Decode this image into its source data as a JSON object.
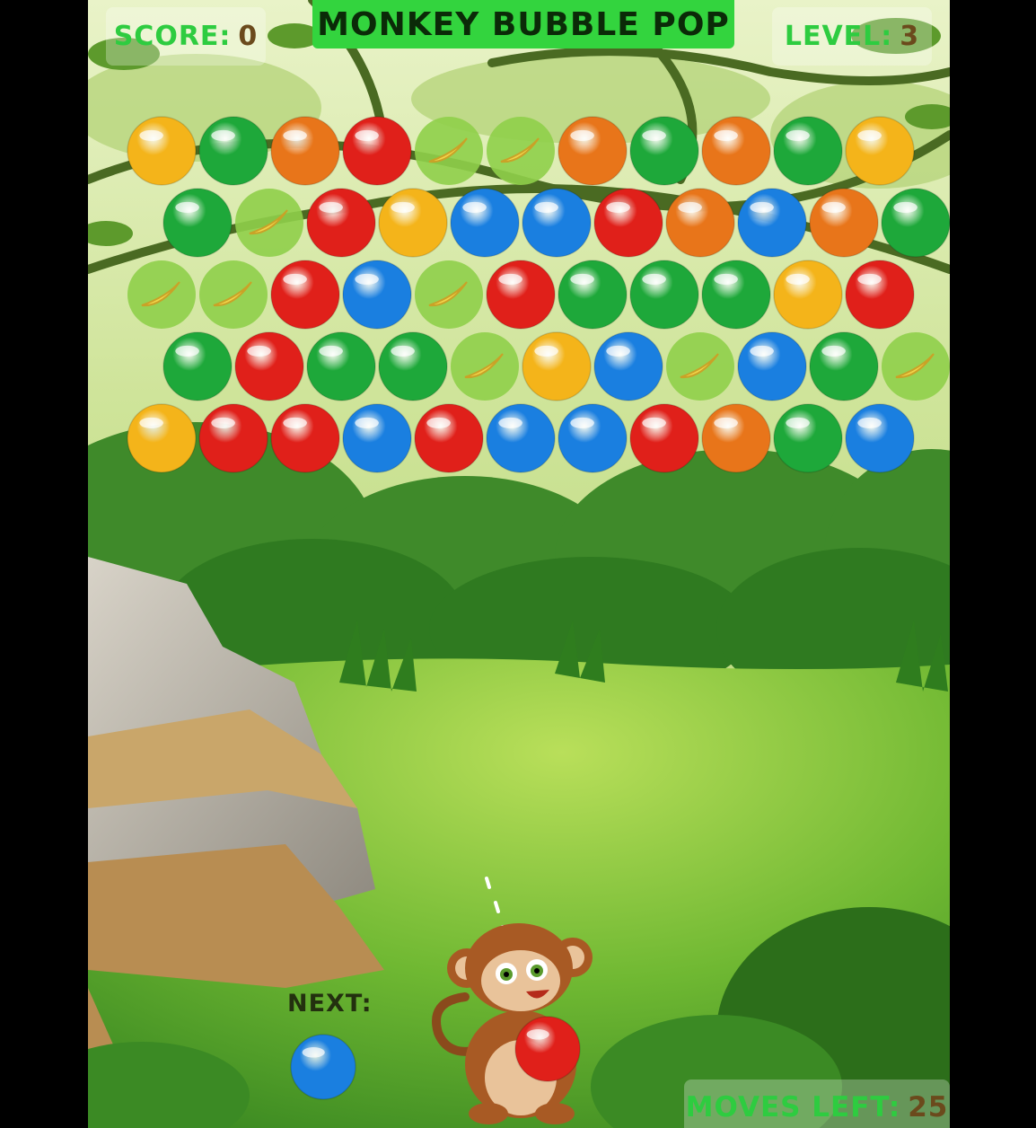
{
  "game": {
    "title": "MONKEY BUBBLE POP"
  },
  "hud": {
    "score_label": "SCORE:",
    "score_value": "0",
    "level_label": "LEVEL:",
    "level_value": "3",
    "moves_label": "MOVES LEFT:",
    "moves_value": "25",
    "next_label": "NEXT:"
  },
  "colors": {
    "yellow": "#f4b41a",
    "green": "#1ea83a",
    "orange": "#e8751a",
    "red": "#e0201a",
    "blue": "#1a7fe0",
    "banana": "#8fcf4a"
  },
  "grid": {
    "rows": [
      [
        "yellow",
        "green",
        "orange",
        "red",
        "banana",
        "banana",
        "orange",
        "green",
        "orange",
        "green",
        "yellow"
      ],
      [
        "green",
        "banana",
        "red",
        "yellow",
        "blue",
        "blue",
        "red",
        "orange",
        "blue",
        "orange",
        "green"
      ],
      [
        "banana",
        "banana",
        "red",
        "blue",
        "banana",
        "red",
        "green",
        "green",
        "green",
        "yellow",
        "red"
      ],
      [
        "green",
        "red",
        "green",
        "green",
        "banana",
        "yellow",
        "blue",
        "banana",
        "blue",
        "green",
        "banana"
      ],
      [
        "yellow",
        "red",
        "red",
        "blue",
        "red",
        "blue",
        "blue",
        "red",
        "orange",
        "green",
        "blue"
      ]
    ]
  },
  "shooter": {
    "current": "red",
    "next": "blue"
  }
}
